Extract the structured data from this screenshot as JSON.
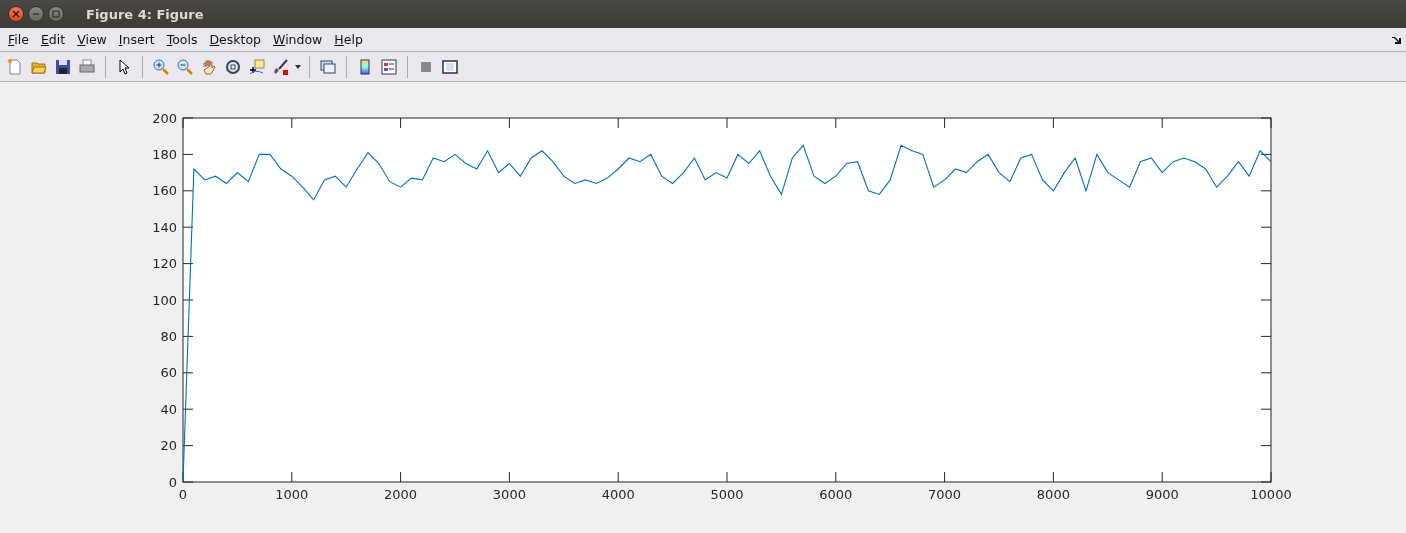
{
  "window": {
    "title": "Figure 4: Figure"
  },
  "menu": [
    "File",
    "Edit",
    "View",
    "Insert",
    "Tools",
    "Desktop",
    "Window",
    "Help"
  ],
  "chart_data": {
    "type": "line",
    "xlim": [
      0,
      10000
    ],
    "ylim": [
      0,
      200
    ],
    "xticks": [
      0,
      1000,
      2000,
      3000,
      4000,
      5000,
      6000,
      7000,
      8000,
      9000,
      10000
    ],
    "yticks": [
      0,
      20,
      40,
      60,
      80,
      100,
      120,
      140,
      160,
      180,
      200
    ],
    "x": [
      0,
      100,
      200,
      300,
      400,
      500,
      600,
      700,
      800,
      900,
      1000,
      1100,
      1200,
      1300,
      1400,
      1500,
      1600,
      1700,
      1800,
      1900,
      2000,
      2100,
      2200,
      2300,
      2400,
      2500,
      2600,
      2700,
      2800,
      2900,
      3000,
      3100,
      3200,
      3300,
      3400,
      3500,
      3600,
      3700,
      3800,
      3900,
      4000,
      4100,
      4200,
      4300,
      4400,
      4500,
      4600,
      4700,
      4800,
      4900,
      5000,
      5100,
      5200,
      5300,
      5400,
      5500,
      5600,
      5700,
      5800,
      5900,
      6000,
      6100,
      6200,
      6300,
      6400,
      6500,
      6600,
      6700,
      6800,
      6900,
      7000,
      7100,
      7200,
      7300,
      7400,
      7500,
      7600,
      7700,
      7800,
      7900,
      8000,
      8100,
      8200,
      8300,
      8400,
      8500,
      8600,
      8700,
      8800,
      8900,
      9000,
      9100,
      9200,
      9300,
      9400,
      9500,
      9600,
      9700,
      9800,
      9900,
      10000
    ],
    "series": [
      {
        "color": "#0072bd",
        "values": [
          0,
          172,
          166,
          168,
          164,
          170,
          165,
          180,
          180,
          172,
          168,
          162,
          155,
          166,
          168,
          162,
          172,
          181,
          175,
          165,
          162,
          167,
          166,
          178,
          176,
          180,
          175,
          172,
          182,
          170,
          175,
          168,
          178,
          182,
          176,
          168,
          164,
          166,
          164,
          167,
          172,
          178,
          176,
          180,
          168,
          164,
          170,
          178,
          166,
          170,
          167,
          180,
          175,
          182,
          168,
          158,
          178,
          185,
          168,
          164,
          168,
          175,
          176,
          160,
          158,
          166,
          185,
          182,
          180,
          162,
          166,
          172,
          170,
          176,
          180,
          170,
          165,
          178,
          180,
          166,
          160,
          170,
          178,
          160,
          180,
          170,
          166,
          162,
          176,
          178,
          170,
          176,
          178,
          176,
          172,
          162,
          168,
          176,
          168,
          182,
          176
        ]
      }
    ]
  }
}
